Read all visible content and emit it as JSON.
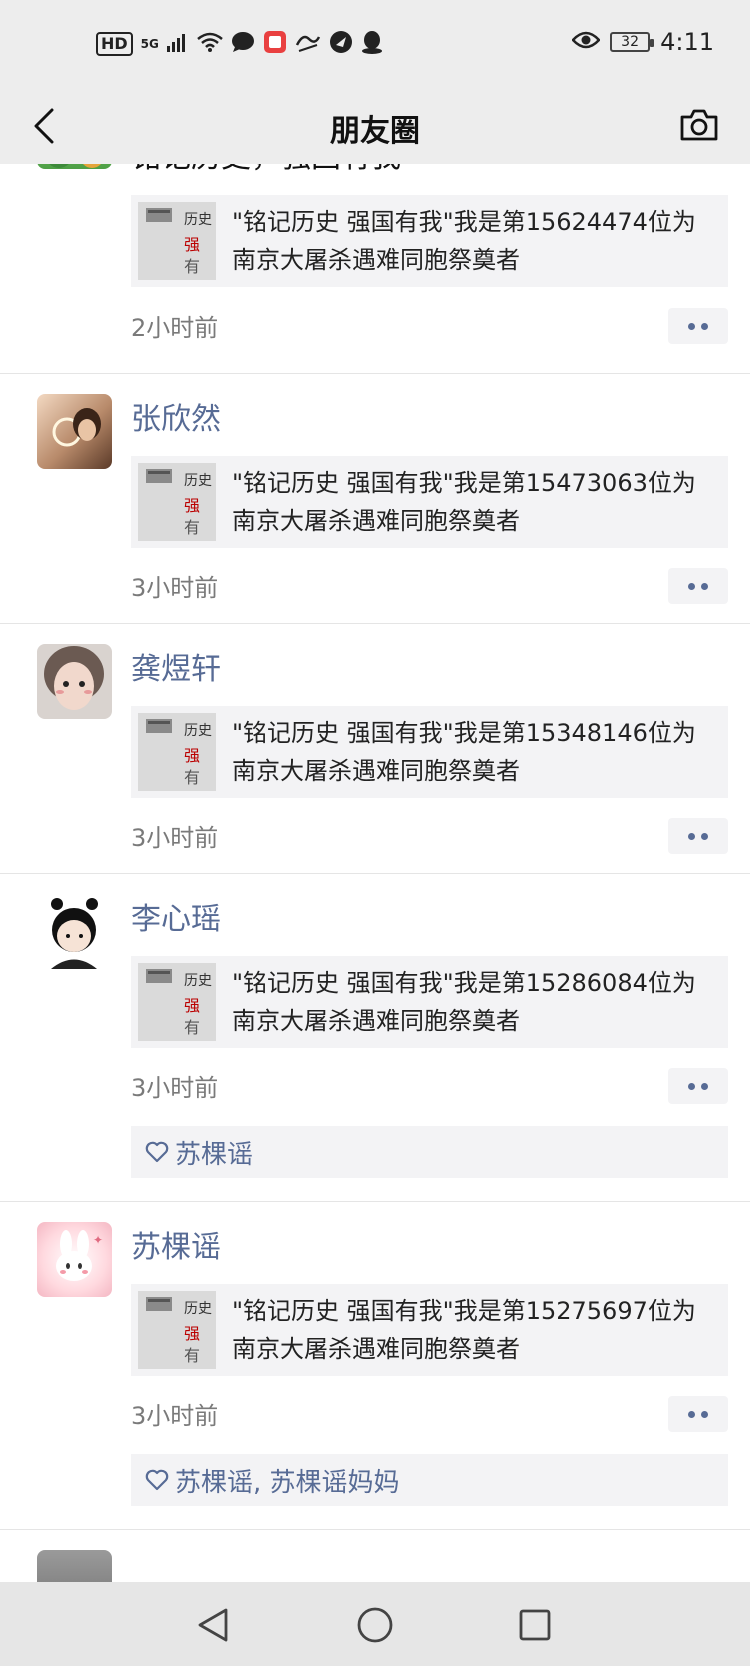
{
  "status_bar": {
    "hd": "HD",
    "network": "5G",
    "battery": "32",
    "time": "4:11",
    "icons": [
      "signal-icon",
      "wifi-icon",
      "message-icon",
      "app-icon",
      "eye-icon"
    ]
  },
  "nav": {
    "title": "朋友圈"
  },
  "posts": [
    {
      "text": "铭记历史，强国有我",
      "share": {
        "line1": "\"铭记历史 强国有我\"我是第15624474位为",
        "line2": "南京大屠杀遇难同胞祭奠者"
      },
      "time": "2小时前"
    },
    {
      "name": "张欣然",
      "share": {
        "line1": "\"铭记历史 强国有我\"我是第15473063位为",
        "line2": "南京大屠杀遇难同胞祭奠者"
      },
      "time": "3小时前"
    },
    {
      "name": "龚煜轩",
      "share": {
        "line1": "\"铭记历史 强国有我\"我是第15348146位为",
        "line2": "南京大屠杀遇难同胞祭奠者"
      },
      "time": "3小时前"
    },
    {
      "name": "李心瑶",
      "share": {
        "line1": "\"铭记历史 强国有我\"我是第15286084位为",
        "line2": "南京大屠杀遇难同胞祭奠者"
      },
      "time": "3小时前",
      "likes": "苏棵谣"
    },
    {
      "name": "苏棵谣",
      "share": {
        "line1": "\"铭记历史 强国有我\"我是第15275697位为",
        "line2": "南京大屠杀遇难同胞祭奠者"
      },
      "time": "3小时前",
      "likes": "苏棵谣, 苏棵谣妈妈"
    }
  ],
  "colors": {
    "name_link": "#576b95",
    "bar_bg": "#ededed",
    "card_bg": "#f3f3f5"
  }
}
